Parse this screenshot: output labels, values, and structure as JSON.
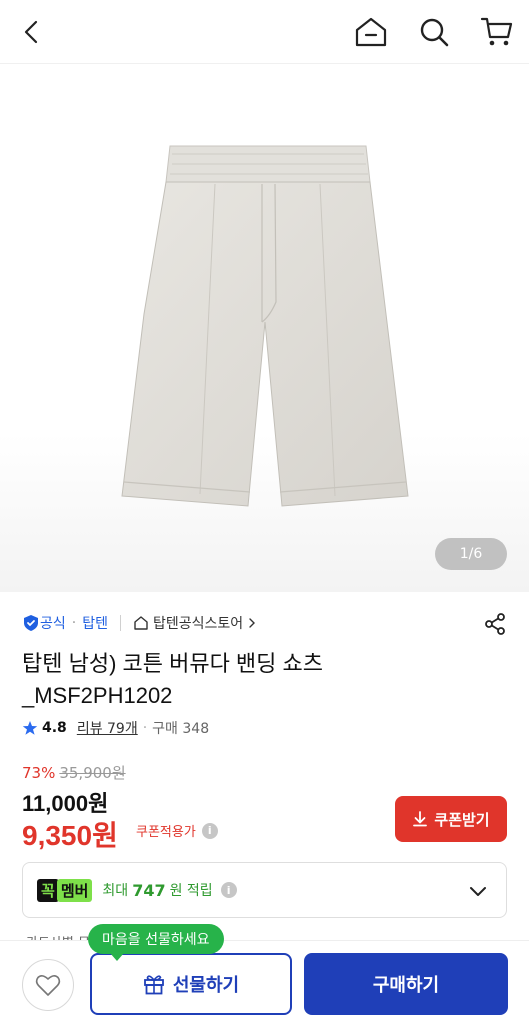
{
  "header": {
    "back_icon": "chevron-left-icon",
    "home_icon": "home-icon",
    "search_icon": "search-icon",
    "cart_icon": "cart-icon"
  },
  "gallery": {
    "counter": "1/6"
  },
  "brand": {
    "official_label": "공식",
    "brand_name": "탑텐",
    "store_name": "탑텐공식스토어"
  },
  "product": {
    "title_line1": "탑텐 남성) 코튼 버뮤다 밴딩 쇼츠",
    "title_line2": "_MSF2PH1202",
    "rating": "4.8",
    "review_text": "리뷰 79개",
    "purchase_text": "구매 348"
  },
  "price": {
    "discount_rate": "73%",
    "original_price": "35,900원",
    "sale_price": "11,000원",
    "coupon_price": "9,350원",
    "coupon_applied_label": "쿠폰적용가",
    "coupon_button": "쿠폰받기"
  },
  "membership": {
    "badge_part1": "꼭",
    "badge_part2": "멤버",
    "max_label": "최대",
    "points": "747",
    "points_suffix": "원 적립"
  },
  "card_benefit": "카드사별 무",
  "tooltip": "마음을 선물하세요",
  "bottom": {
    "gift_label": "선물하기",
    "buy_label": "구매하기"
  },
  "colors": {
    "accent_blue": "#1f3fb8",
    "sale_red": "#e0352b",
    "member_green": "#27b34a"
  }
}
